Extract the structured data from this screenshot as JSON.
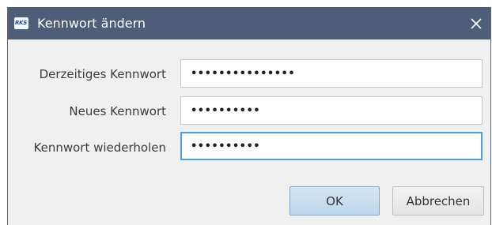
{
  "window": {
    "title": "Kennwort ändern",
    "app_icon_text": "RKS",
    "app_icon_name": "rks-app-icon",
    "close_icon_name": "close-icon",
    "titlebar_color": "#4e5e78",
    "focus_color": "#4a9ee3"
  },
  "form": {
    "current_password": {
      "label": "Derzeitiges Kennwort",
      "value": "•••••••••••••••"
    },
    "new_password": {
      "label": "Neues Kennwort",
      "value": "••••••••••"
    },
    "repeat_password": {
      "label": "Kennwort wiederholen",
      "value": "••••••••••"
    }
  },
  "buttons": {
    "ok_label": "OK",
    "cancel_label": "Abbrechen"
  }
}
